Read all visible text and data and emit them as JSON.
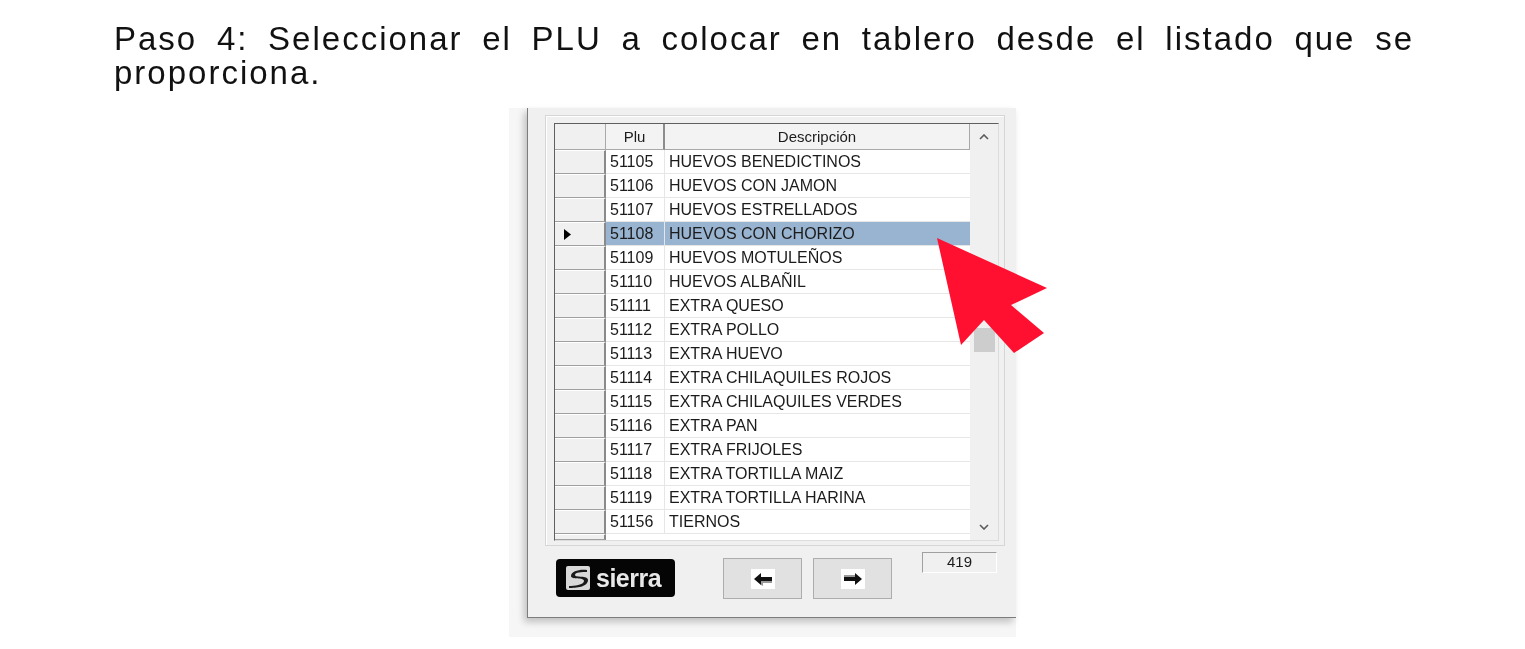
{
  "instruction": "Paso 4: Seleccionar el PLU a colocar en tablero desde el listado que se proporciona.",
  "grid": {
    "columns": [
      "Plu",
      "Descripción"
    ],
    "rows": [
      {
        "plu": "51105",
        "description": "HUEVOS BENEDICTINOS",
        "selected": false
      },
      {
        "plu": "51106",
        "description": "HUEVOS CON JAMON",
        "selected": false
      },
      {
        "plu": "51107",
        "description": "HUEVOS ESTRELLADOS",
        "selected": false
      },
      {
        "plu": "51108",
        "description": "HUEVOS CON CHORIZO",
        "selected": true
      },
      {
        "plu": "51109",
        "description": "HUEVOS MOTULEÑOS",
        "selected": false
      },
      {
        "plu": "51110",
        "description": "HUEVOS ALBAÑIL",
        "selected": false
      },
      {
        "plu": "51111",
        "description": "EXTRA QUESO",
        "selected": false
      },
      {
        "plu": "51112",
        "description": "EXTRA POLLO",
        "selected": false
      },
      {
        "plu": "51113",
        "description": "EXTRA HUEVO",
        "selected": false
      },
      {
        "plu": "51114",
        "description": "EXTRA CHILAQUILES ROJOS",
        "selected": false
      },
      {
        "plu": "51115",
        "description": "EXTRA CHILAQUILES VERDES",
        "selected": false
      },
      {
        "plu": "51116",
        "description": "EXTRA PAN",
        "selected": false
      },
      {
        "plu": "51117",
        "description": "EXTRA FRIJOLES",
        "selected": false
      },
      {
        "plu": "51118",
        "description": "EXTRA TORTILLA MAIZ",
        "selected": false
      },
      {
        "plu": "51119",
        "description": "EXTRA TORTILLA HARINA",
        "selected": false
      },
      {
        "plu": "51156",
        "description": "TIERNOS",
        "selected": false
      }
    ]
  },
  "logo": {
    "text": "sierra"
  },
  "record_count": "419"
}
